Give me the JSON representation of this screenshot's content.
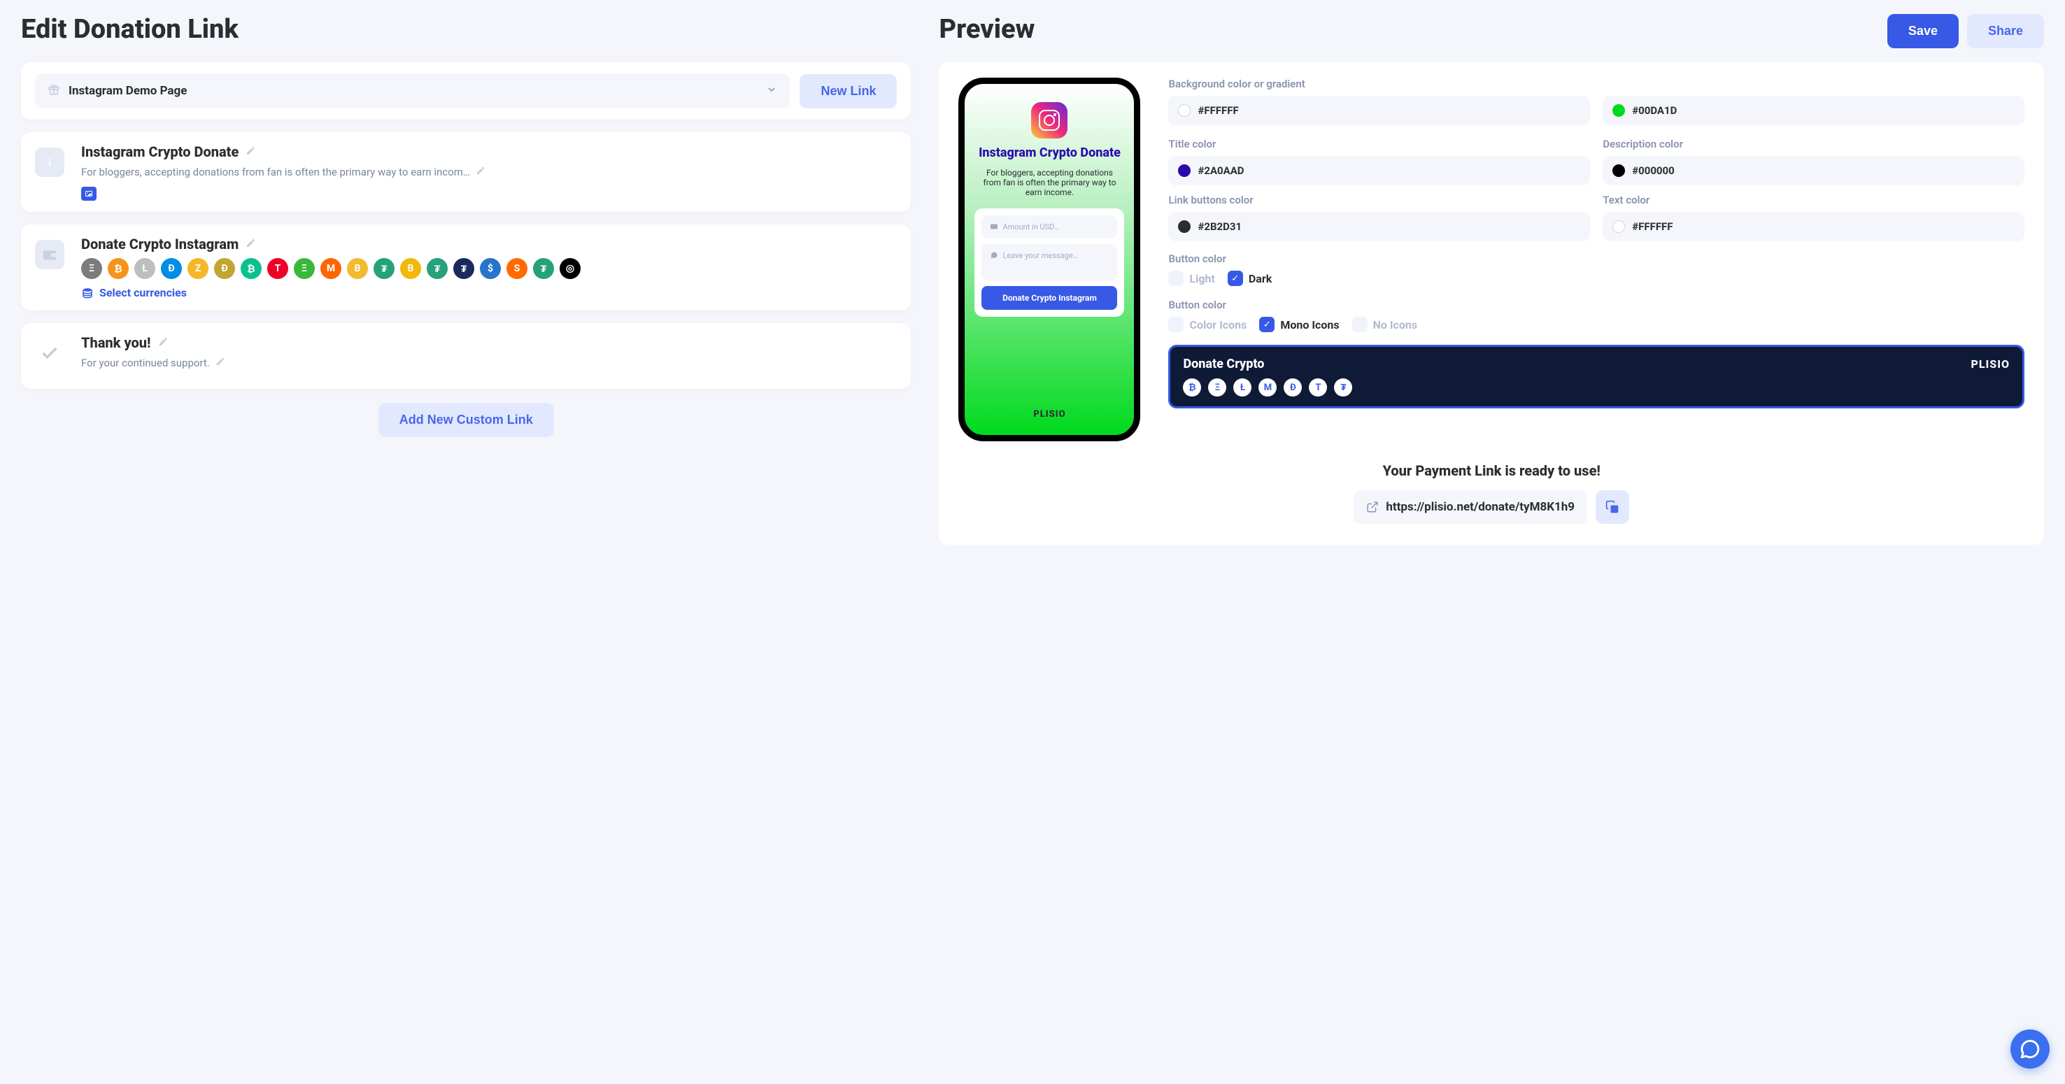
{
  "left": {
    "title": "Edit Donation Link",
    "page_select": "Instagram Demo Page",
    "new_link_label": "New Link",
    "cards": {
      "info": {
        "title": "Instagram Crypto Donate",
        "desc": "For bloggers, accepting donations from fan is often the primary way to earn incom…"
      },
      "wallet": {
        "title": "Donate Crypto Instagram",
        "select_currencies": "Select currencies"
      },
      "thanks": {
        "title": "Thank you!",
        "desc": "For your continued support."
      }
    },
    "add_custom_link": "Add New Custom Link"
  },
  "right": {
    "title": "Preview",
    "save": "Save",
    "share": "Share"
  },
  "colors": {
    "bg_label": "Background color or gradient",
    "bg1": "#FFFFFF",
    "bg2": "#00DA1D",
    "title_label": "Title color",
    "title": "#2A0AAD",
    "desc_label": "Description color",
    "desc": "#000000",
    "linkbtn_label": "Link buttons color",
    "linkbtn": "#2B2D31",
    "text_label": "Text color",
    "text": "#FFFFFF"
  },
  "button_theme": {
    "label": "Button color",
    "light": "Light",
    "dark": "Dark"
  },
  "icon_mode": {
    "label": "Button color",
    "color": "Color Icons",
    "mono": "Mono Icons",
    "none": "No Icons"
  },
  "banner": {
    "title": "Donate Crypto",
    "logo": "PLISIO"
  },
  "preview_phone": {
    "title": "Instagram Crypto Donate",
    "desc": "For bloggers, accepting donations from fan is often the primary way to earn income.",
    "amount_placeholder": "Amount in USD…",
    "message_placeholder": "Leave your message…",
    "button": "Donate Crypto Instagram",
    "brand": "PLISIO"
  },
  "ready": {
    "title": "Your Payment Link is ready to use!",
    "url": "https://plisio.net/donate/tyM8K1h9"
  },
  "crypto_icons": [
    {
      "bg": "#7c7c7c",
      "glyph": "Ξ"
    },
    {
      "bg": "#f7931a",
      "glyph": "₿"
    },
    {
      "bg": "#bebebe",
      "glyph": "Ł"
    },
    {
      "bg": "#008de4",
      "glyph": "Đ"
    },
    {
      "bg": "#f4b728",
      "glyph": "Z"
    },
    {
      "bg": "#c2a633",
      "glyph": "Ð"
    },
    {
      "bg": "#0ac18e",
      "glyph": "₿"
    },
    {
      "bg": "#ef0027",
      "glyph": "T"
    },
    {
      "bg": "#3ab83a",
      "glyph": "Ξ"
    },
    {
      "bg": "#ff6600",
      "glyph": "M"
    },
    {
      "bg": "#f3ba2f",
      "glyph": "B"
    },
    {
      "bg": "#26a17b",
      "glyph": "₮"
    },
    {
      "bg": "#f0b90b",
      "glyph": "B"
    },
    {
      "bg": "#26a17b",
      "glyph": "₮"
    },
    {
      "bg": "#1b295e",
      "glyph": "₮"
    },
    {
      "bg": "#2775ca",
      "glyph": "$"
    },
    {
      "bg": "#ff6b00",
      "glyph": "S"
    },
    {
      "bg": "#26a17b",
      "glyph": "₮"
    },
    {
      "bg": "#000000",
      "glyph": "◎"
    }
  ],
  "banner_icons": [
    "₿",
    "Ξ",
    "Ł",
    "M",
    "Đ",
    "T",
    "₮"
  ]
}
